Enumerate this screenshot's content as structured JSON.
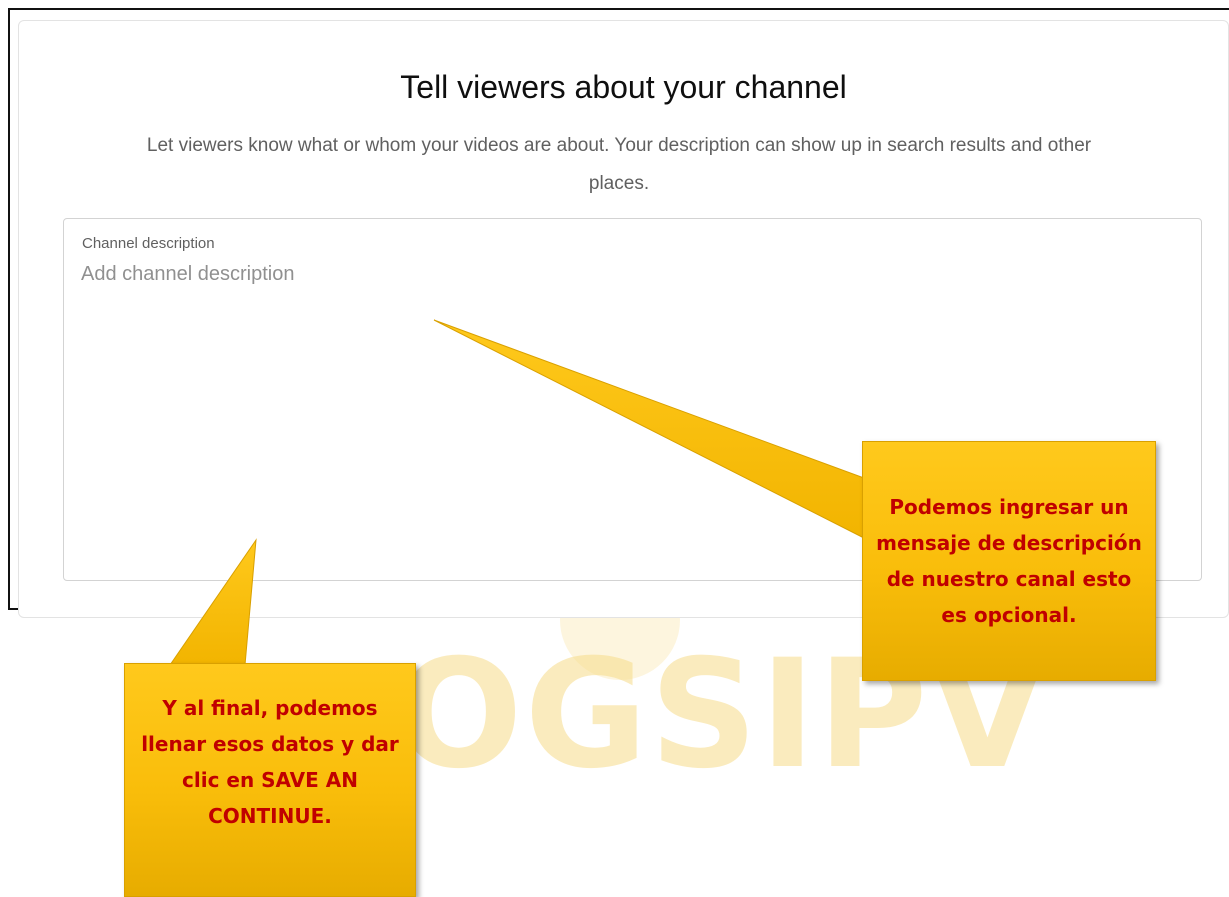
{
  "watermark": {
    "text": "OGSIPV"
  },
  "card": {
    "title": "Tell viewers about your channel",
    "subtitle": "Let viewers know what or whom your videos are about. Your description can show up in search results and other places."
  },
  "description_field": {
    "label": "Channel description",
    "placeholder": "Add channel description",
    "value": ""
  },
  "callouts": {
    "right": "Podemos ingresar un mensaje de descripción de nuestro canal esto es opcional.",
    "left": "Y al final, podemos llenar esos datos y dar clic en SAVE AN CONTINUE."
  },
  "colors": {
    "callout_fill": "#f9bd0a",
    "callout_text": "#c00000",
    "watermark": "#f7dc8a"
  }
}
